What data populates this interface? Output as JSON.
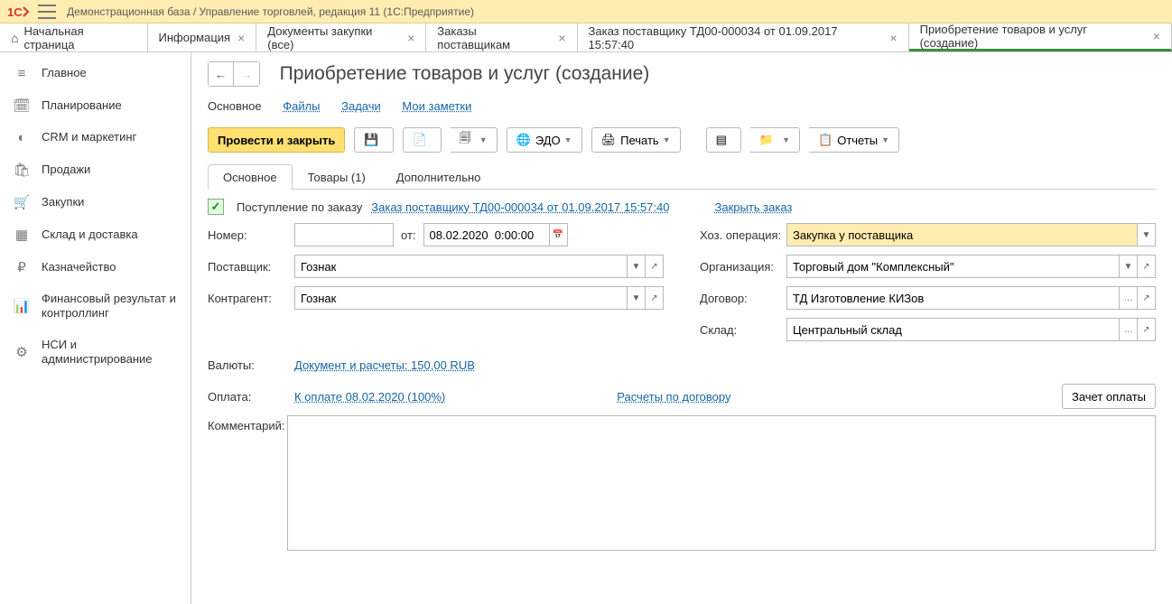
{
  "titlebar": {
    "text": "Демонстрационная база / Управление торговлей, редакция 11  (1С:Предприятие)"
  },
  "tabs": [
    {
      "label": "Начальная страница",
      "closable": false,
      "home": true
    },
    {
      "label": "Информация",
      "closable": true
    },
    {
      "label": "Документы закупки (все)",
      "closable": true
    },
    {
      "label": "Заказы поставщикам",
      "closable": true
    },
    {
      "label": "Заказ поставщику ТД00-000034 от 01.09.2017 15:57:40",
      "closable": true
    },
    {
      "label": "Приобретение товаров и услуг (создание)",
      "closable": true,
      "active": true
    }
  ],
  "sidebar": [
    {
      "icon": "≡",
      "label": "Главное"
    },
    {
      "icon": "📅",
      "label": "Планирование"
    },
    {
      "icon": "◐",
      "label": "CRM и маркетинг"
    },
    {
      "icon": "🛍",
      "label": "Продажи"
    },
    {
      "icon": "🛒",
      "label": "Закупки"
    },
    {
      "icon": "▦",
      "label": "Склад и доставка"
    },
    {
      "icon": "₽",
      "label": "Казначейство"
    },
    {
      "icon": "📊",
      "label": "Финансовый результат и контроллинг"
    },
    {
      "icon": "⚙",
      "label": "НСИ и администрирование"
    }
  ],
  "page": {
    "title": "Приобретение товаров и услуг (создание)",
    "links": {
      "main": "Основное",
      "files": "Файлы",
      "tasks": "Задачи",
      "notes": "Мои заметки"
    },
    "toolbar": {
      "submit": "Провести и закрыть",
      "edo": "ЭДО",
      "print": "Печать",
      "reports": "Отчеты"
    },
    "subtabs": {
      "main": "Основное",
      "goods": "Товары (1)",
      "extra": "Дополнительно"
    },
    "order_row": {
      "check_label": "Поступление по заказу",
      "order_link": "Заказ поставщику ТД00-000034 от 01.09.2017 15:57:40",
      "close_link": "Закрыть заказ"
    },
    "fields": {
      "number_label": "Номер:",
      "number": "",
      "from_label": "от:",
      "date": "08.02.2020  0:00:00",
      "supplier_label": "Поставщик:",
      "supplier": "Гознак",
      "counterparty_label": "Контрагент:",
      "counterparty": "Гознак",
      "hoz_label": "Хоз. операция:",
      "hoz": "Закупка у поставщика",
      "org_label": "Организация:",
      "org": "Торговый дом \"Комплексный\"",
      "contract_label": "Договор:",
      "contract": "ТД Изготовление КИЗов",
      "warehouse_label": "Склад:",
      "warehouse": "Центральный склад",
      "currency_label": "Валюты:",
      "currency_link": "Документ и расчеты: 150,00 RUB",
      "payment_label": "Оплата:",
      "payment_link": "К оплате 08.02.2020 (100%)",
      "calc_link": "Расчеты по договору",
      "offset_btn": "Зачет оплаты",
      "comment_label": "Комментарий:",
      "comment": ""
    }
  }
}
